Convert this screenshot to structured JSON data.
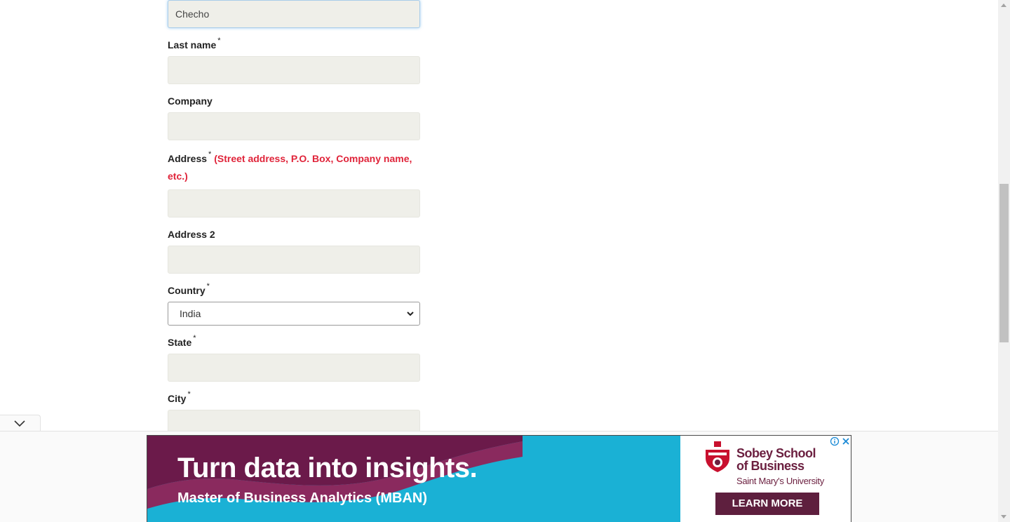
{
  "form": {
    "first_name_value": "Checho",
    "last_name": {
      "label": "Last name",
      "required": "*"
    },
    "company": {
      "label": "Company"
    },
    "address": {
      "label": "Address",
      "required": "*",
      "hint": "(Street address, P.O. Box, Company name, etc.)"
    },
    "address2": {
      "label": "Address 2"
    },
    "country": {
      "label": "Country",
      "required": "*",
      "value": "India"
    },
    "state": {
      "label": "State",
      "required": "*"
    },
    "city": {
      "label": "City",
      "required": "*"
    }
  },
  "ad": {
    "headline": "Turn data into insights.",
    "subline": "Master of Business Analytics (MBAN)",
    "school_line1": "Sobey School",
    "school_line2": "of Business",
    "university": "Saint Mary's University",
    "cta": "LEARN MORE",
    "colors": {
      "background": "#1ab1d5",
      "brand": "#5e1f3e"
    }
  },
  "icons": [
    "chevron-down-icon",
    "info-icon",
    "close-icon",
    "school-crest-icon"
  ]
}
